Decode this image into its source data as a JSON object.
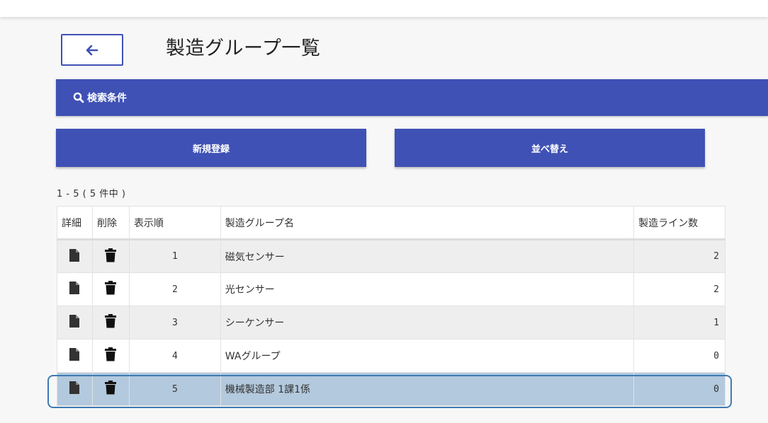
{
  "header": {
    "title": "製造グループ一覧"
  },
  "search": {
    "label": "検索条件"
  },
  "actions": {
    "new_label": "新規登録",
    "sort_label": "並べ替え"
  },
  "pagination": {
    "summary": "1 - 5 ( 5 件中 )"
  },
  "table": {
    "headers": {
      "detail": "詳細",
      "delete": "削除",
      "order": "表示順",
      "name": "製造グループ名",
      "lines": "製造ライン数"
    },
    "rows": [
      {
        "order": "1",
        "name": "磁気センサー",
        "lines": "2"
      },
      {
        "order": "2",
        "name": "光センサー",
        "lines": "2"
      },
      {
        "order": "3",
        "name": "シーケンサー",
        "lines": "1"
      },
      {
        "order": "4",
        "name": "WAグループ",
        "lines": "0"
      },
      {
        "order": "5",
        "name": "機械製造部 1課1係",
        "lines": "0",
        "selected": true
      }
    ]
  },
  "icons": {
    "back": "arrow-left-icon",
    "search": "search-icon",
    "detail": "document-icon",
    "delete": "trash-icon"
  },
  "colors": {
    "primary": "#3f51b5",
    "selected_row": "#b3c9dd",
    "selected_outline": "#3d7ab5",
    "striped_row": "#eeeeee"
  }
}
